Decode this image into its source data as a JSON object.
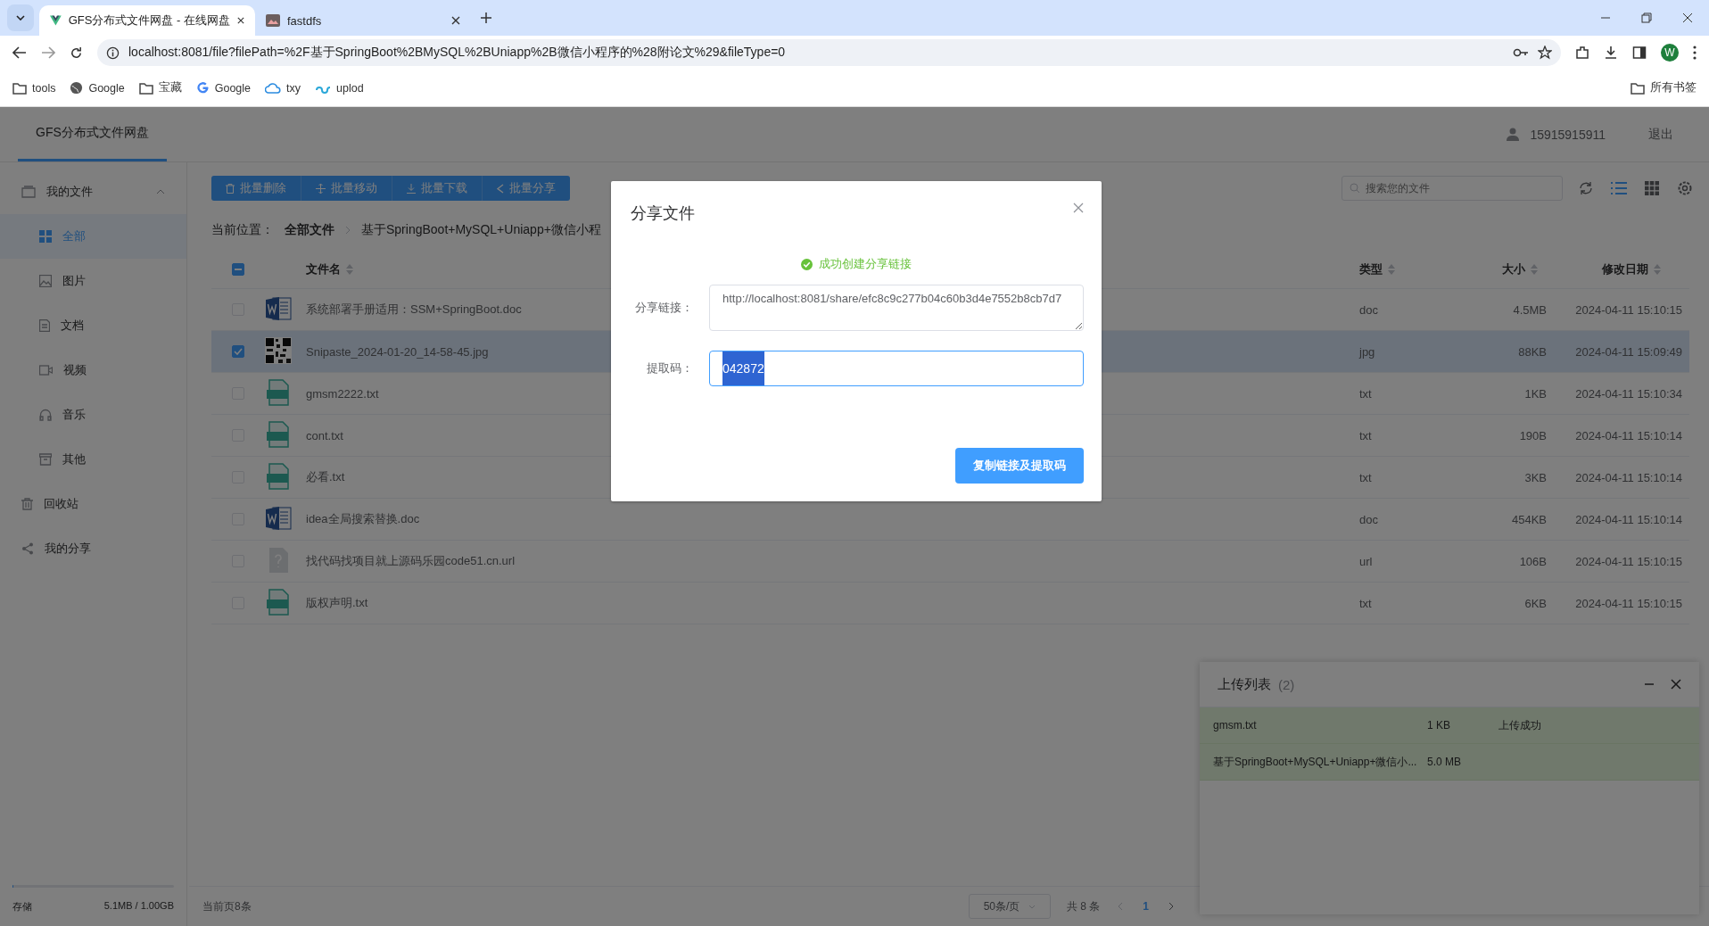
{
  "browser": {
    "tabs": [
      {
        "title": "GFS分布式文件网盘 - 在线网盘",
        "kind": "app",
        "selected": true
      },
      {
        "title": "fastdfs",
        "kind": "image",
        "selected": false
      }
    ],
    "url": "localhost:8081/file?filePath=%2F基于SpringBoot%2BMySQL%2BUniapp%2B微信小程序的%28附论文%29&fileType=0",
    "profile_initial": "W",
    "bookmarks": [
      {
        "label": "tools",
        "kind": "folder"
      },
      {
        "label": "Google",
        "kind": "globe"
      },
      {
        "label": "宝藏",
        "kind": "folder"
      },
      {
        "label": "Google",
        "kind": "google"
      },
      {
        "label": "txy",
        "kind": "cloud"
      },
      {
        "label": "uplod",
        "kind": "link"
      }
    ],
    "all_bookmarks": "所有书签"
  },
  "app": {
    "title": "GFS分布式文件网盘",
    "user": "15915915911",
    "logout": "退出"
  },
  "sidebar": {
    "items": [
      {
        "label": "我的文件",
        "kind": "files",
        "selected": false,
        "expanded": true,
        "children": [
          {
            "label": "全部",
            "kind": "all",
            "selected": true
          },
          {
            "label": "图片",
            "kind": "image",
            "selected": false
          },
          {
            "label": "文档",
            "kind": "doc",
            "selected": false
          },
          {
            "label": "视频",
            "kind": "video",
            "selected": false
          },
          {
            "label": "音乐",
            "kind": "music",
            "selected": false
          },
          {
            "label": "其他",
            "kind": "other",
            "selected": false
          }
        ]
      },
      {
        "label": "回收站",
        "kind": "trash",
        "selected": false,
        "expanded": false
      },
      {
        "label": "我的分享",
        "kind": "share",
        "selected": false,
        "expanded": false
      }
    ],
    "storage": {
      "label": "存储",
      "usage": "5.1MB / 1.00GB",
      "level": 0.005
    }
  },
  "toolbar": {
    "buttons": [
      {
        "label": "批量删除",
        "kind": "delete"
      },
      {
        "label": "批量移动",
        "kind": "move"
      },
      {
        "label": "批量下载",
        "kind": "download"
      },
      {
        "label": "批量分享",
        "kind": "share"
      }
    ],
    "search": {
      "placeholder": "搜索您的文件"
    },
    "view_modes": [
      {
        "kind": "list",
        "selected": true
      },
      {
        "kind": "grid",
        "selected": false
      }
    ]
  },
  "breadcrumb": {
    "label": "当前位置：",
    "items": [
      "全部文件",
      "基于SpringBoot+MySQL+Uniapp+微信小程"
    ]
  },
  "table": {
    "indeterminate": true,
    "columns": [
      "文件名",
      "类型",
      "大小",
      "修改日期"
    ],
    "rows": [
      {
        "name": "系统部署手册适用：SSM+SpringBoot.doc",
        "type": "doc",
        "size": "4.5MB",
        "date": "2024-04-11 15:10:15",
        "kind": "doc",
        "checked": false,
        "selected": false
      },
      {
        "name": "Snipaste_2024-01-20_14-58-45.jpg",
        "type": "jpg",
        "size": "88KB",
        "date": "2024-04-11 15:09:49",
        "kind": "image",
        "checked": true,
        "selected": true
      },
      {
        "name": "gmsm2222.txt",
        "type": "txt",
        "size": "1KB",
        "date": "2024-04-11 15:10:34",
        "kind": "txt",
        "checked": false,
        "selected": false
      },
      {
        "name": "cont.txt",
        "type": "txt",
        "size": "190B",
        "date": "2024-04-11 15:10:14",
        "kind": "txt",
        "checked": false,
        "selected": false
      },
      {
        "name": "必看.txt",
        "type": "txt",
        "size": "3KB",
        "date": "2024-04-11 15:10:14",
        "kind": "txt",
        "checked": false,
        "selected": false
      },
      {
        "name": "idea全局搜索替换.doc",
        "type": "doc",
        "size": "454KB",
        "date": "2024-04-11 15:10:14",
        "kind": "doc",
        "checked": false,
        "selected": false
      },
      {
        "name": "找代码找项目就上源码乐园code51.cn.url",
        "type": "url",
        "size": "106B",
        "date": "2024-04-11 15:10:15",
        "kind": "other",
        "checked": false,
        "selected": false
      },
      {
        "name": "版权声明.txt",
        "type": "txt",
        "size": "6KB",
        "date": "2024-04-11 15:10:15",
        "kind": "txt",
        "checked": false,
        "selected": false
      }
    ]
  },
  "footer": {
    "page_info": "当前页8条",
    "page_size": "50条/页",
    "total": "共 8 条",
    "pages": [
      {
        "label": "1",
        "selected": true
      }
    ]
  },
  "upload_list": {
    "title": "上传列表",
    "count": "(2)",
    "items": [
      {
        "name": "gmsm.txt",
        "size": "1 KB",
        "status": "上传成功"
      },
      {
        "name": "基于SpringBoot+MySQL+Uniapp+微信小...",
        "size": "5.0 MB"
      }
    ]
  },
  "dialog": {
    "title": "分享文件",
    "message": "成功创建分享链接",
    "link_label": "分享链接：",
    "link": "http://localhost:8081/share/efc8c9c277b04c60b3d4e7552b8cb7d7",
    "code_label": "提取码：",
    "code": "042872",
    "button": "复制链接及提取码"
  }
}
